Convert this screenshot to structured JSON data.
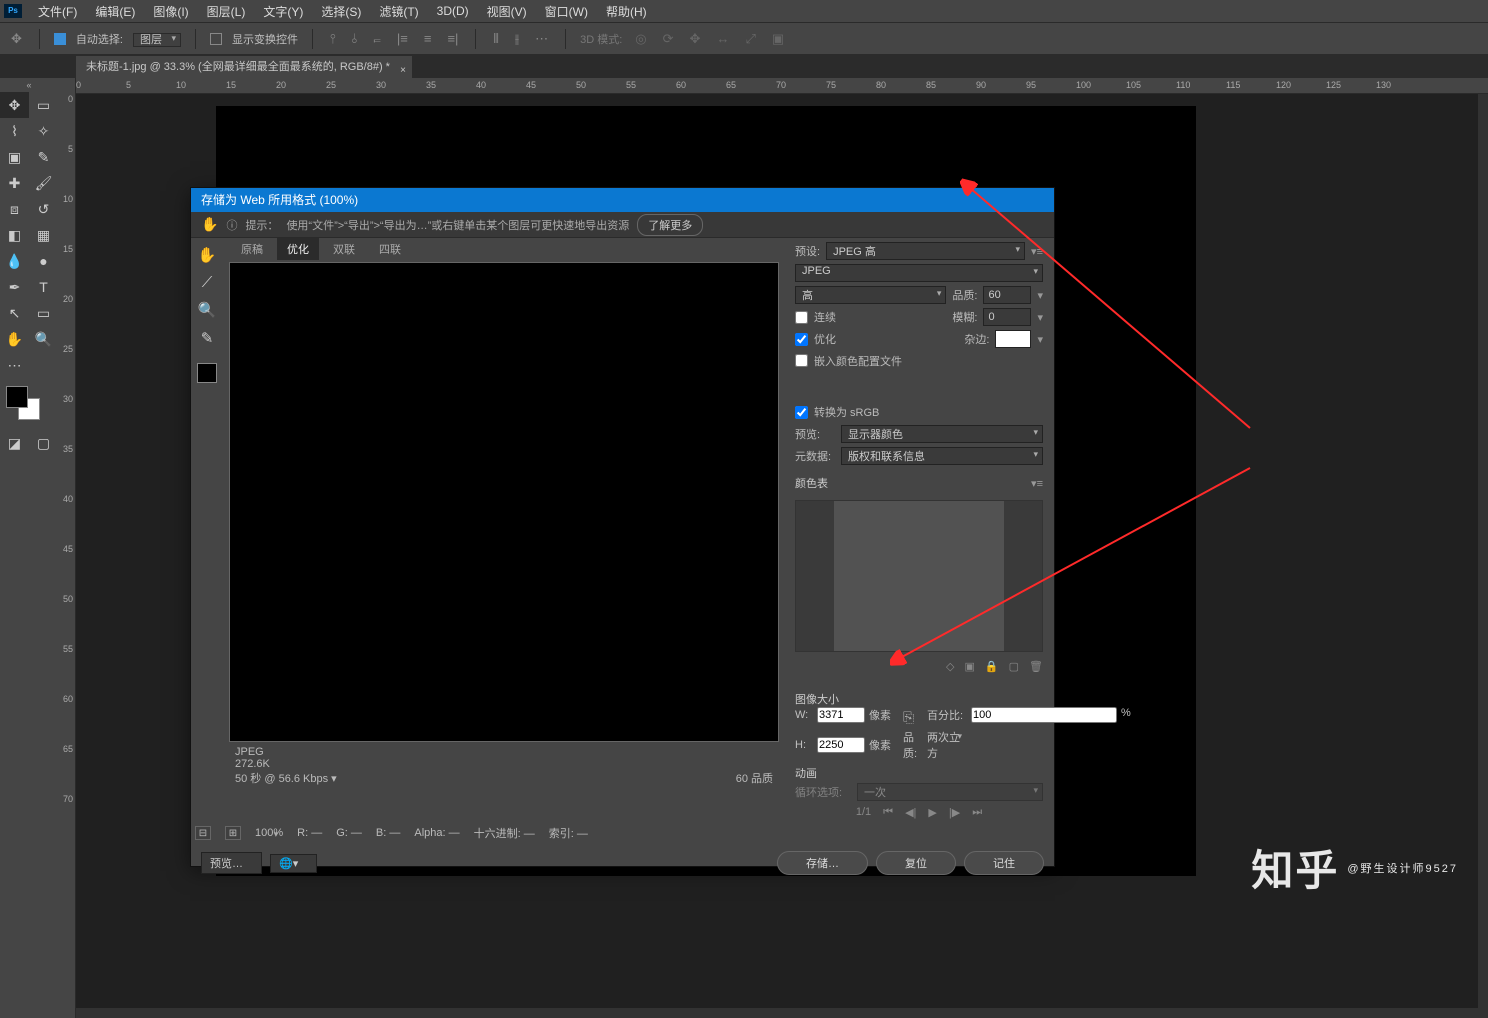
{
  "menubar": {
    "logo": "Ps",
    "items": [
      "文件(F)",
      "编辑(E)",
      "图像(I)",
      "图层(L)",
      "文字(Y)",
      "选择(S)",
      "滤镜(T)",
      "3D(D)",
      "视图(V)",
      "窗口(W)",
      "帮助(H)"
    ]
  },
  "optbar": {
    "move": "✥",
    "autoSel": "自动选择:",
    "layerSel": "图层",
    "showCtl": "显示变换控件",
    "d3": "3D 模式:"
  },
  "tab": {
    "title": "未标题-1.jpg @ 33.3% (全网最详细最全面最系统的, RGB/8#) *"
  },
  "hTicks": [
    "0",
    "5",
    "10",
    "15",
    "20",
    "25",
    "30",
    "35",
    "40",
    "45",
    "50",
    "55",
    "60",
    "65",
    "70",
    "75",
    "80",
    "85",
    "90",
    "95",
    "100",
    "105",
    "110",
    "115",
    "120",
    "125",
    "130"
  ],
  "vTicks": [
    "0",
    "5",
    "10",
    "15",
    "20",
    "25",
    "30",
    "35",
    "40",
    "45",
    "50",
    "55",
    "60",
    "65",
    "70"
  ],
  "dlg": {
    "title": "存储为 Web 所用格式 (100%)",
    "tipPrefix": "提示：",
    "tip": "使用“文件”>“导出”>“导出为…”或右键单击某个图层可更快速地导出资源",
    "learnMore": "了解更多",
    "tabs": [
      "原稿",
      "优化",
      "双联",
      "四联"
    ],
    "activeTab": "优化",
    "meta": {
      "fmt": "JPEG",
      "size": "272.6K",
      "time": "50 秒 @ 56.6 Kbps ▾",
      "quality": "60 品质"
    },
    "preset": {
      "label": "预设:",
      "value": "JPEG 高"
    },
    "format": "JPEG",
    "qualityLevel": "高",
    "qualityLabel": "品质:",
    "qualityVal": "60",
    "progressive": "连续",
    "optimize": "优化",
    "embed": "嵌入颜色配置文件",
    "blurLabel": "模糊:",
    "blurVal": "0",
    "matteLabel": "杂边:",
    "convertSRGB": "转换为 sRGB",
    "previewLabel": "预览:",
    "previewVal": "显示器颜色",
    "metaLabel": "元数据:",
    "metaVal": "版权和联系信息",
    "colorTable": "颜色表",
    "imageSize": {
      "title": "图像大小",
      "w": "W:",
      "wVal": "3371",
      "h": "H:",
      "hVal": "2250",
      "unit": "像素",
      "pctLabel": "百分比:",
      "pctVal": "100",
      "pctUnit": "%",
      "qLabel": "品质:",
      "qVal": "两次立方"
    },
    "anim": {
      "title": "动画",
      "loopLabel": "循环选项:",
      "loopVal": "一次",
      "frame": "1/1"
    },
    "statusBar": {
      "zoom": "100%",
      "r": "R:",
      "g": "G:",
      "b": "B:",
      "alpha": "Alpha:",
      "hex": "十六进制:",
      "idx": "索引:",
      "dash": "—"
    },
    "footer": {
      "preview": "预览…",
      "save": "存储…",
      "reset": "复位",
      "remember": "记住"
    }
  },
  "watermark": {
    "logo": "知乎",
    "text": "@野生设计师9527"
  }
}
